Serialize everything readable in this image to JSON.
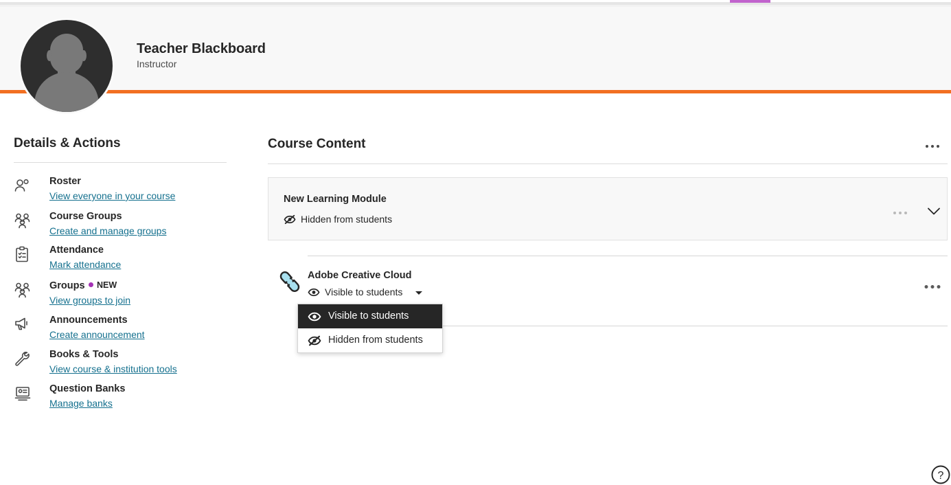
{
  "app": {
    "accent_orange": "#f26f21",
    "link_color": "#14708e",
    "new_dot_color": "#a432b5",
    "tab_indicator_color": "#c163cd",
    "menu_selected_bg": "#262626"
  },
  "profile": {
    "name": "Teacher Blackboard",
    "role": "Instructor",
    "avatar_icon": "user-avatar-placeholder"
  },
  "sidebar": {
    "title": "Details & Actions",
    "items": [
      {
        "label": "Roster",
        "link": "View everyone in your course",
        "icon": "roster-people-icon",
        "badge": null
      },
      {
        "label": "Course Groups",
        "link": "Create and manage groups",
        "icon": "course-groups-icon",
        "badge": null
      },
      {
        "label": "Attendance",
        "link": "Mark attendance",
        "icon": "attendance-clipboard-icon",
        "badge": null
      },
      {
        "label": "Groups",
        "link": "View groups to join",
        "icon": "groups-icon",
        "badge": "NEW"
      },
      {
        "label": "Announcements",
        "link": "Create announcement",
        "icon": "megaphone-icon",
        "badge": null
      },
      {
        "label": "Books & Tools",
        "link": "View course & institution tools",
        "icon": "wrench-icon",
        "badge": null
      },
      {
        "label": "Question Banks",
        "link": "Manage banks",
        "icon": "question-bank-icon",
        "badge": null
      }
    ]
  },
  "content": {
    "title": "Course Content",
    "overflow_icon": "more-options-icon",
    "module": {
      "title": "New Learning Module",
      "visibility": "Hidden from students",
      "visibility_icon": "eye-slash-icon",
      "overflow_icon": "more-options-icon",
      "expand_icon": "chevron-down-icon"
    },
    "item": {
      "title": "Adobe Creative Cloud",
      "icon": "link-chain-icon",
      "visibility": "Visible to students",
      "visibility_icon": "eye-icon",
      "caret_icon": "caret-down-icon",
      "overflow_icon": "more-options-icon"
    }
  },
  "visibility_menu": {
    "options": [
      {
        "label": "Visible to students",
        "icon": "eye-icon",
        "selected": true
      },
      {
        "label": "Hidden from students",
        "icon": "eye-slash-icon",
        "selected": false
      }
    ]
  },
  "help": {
    "icon": "help-question-icon",
    "label": "?"
  }
}
